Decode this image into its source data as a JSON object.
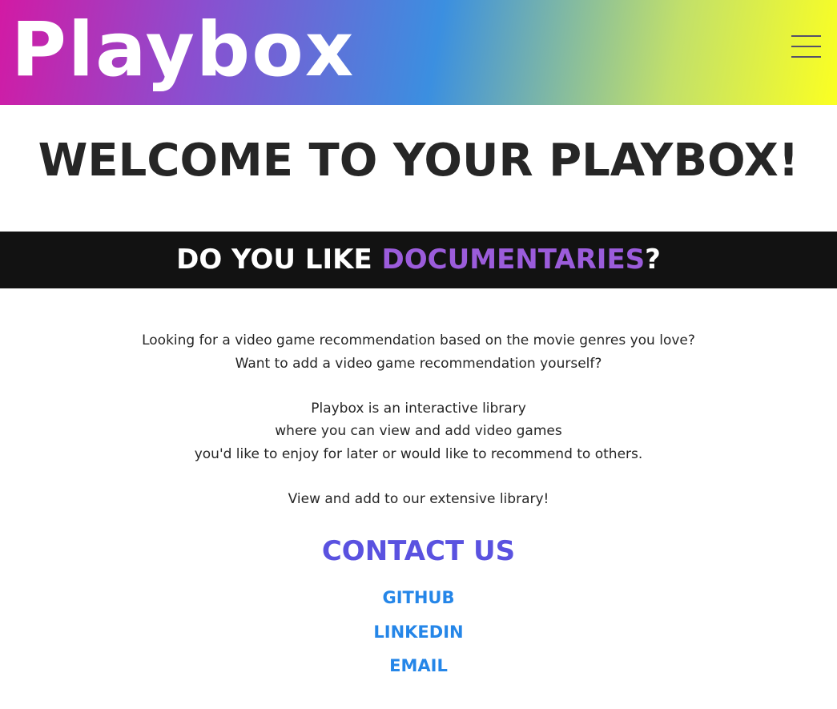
{
  "header": {
    "logo_text": "Playbox",
    "menu_icon": "hamburger-menu-icon",
    "gradient_colors": [
      "#d21aa4",
      "#8a4fd0",
      "#3b8fe0",
      "#c2e06a",
      "#fbff22"
    ]
  },
  "main": {
    "welcome_title": "WELCOME TO YOUR PLAYBOX!",
    "banner": {
      "prefix": "DO YOU LIKE ",
      "genre": "DOCUMENTARIES",
      "suffix": "?",
      "genre_color": "#9b5cdb",
      "background": "#121212"
    },
    "intro_lines": [
      "Looking for a video game recommendation based on the movie genres you love?",
      "Want to add a video game recommendation yourself?",
      "Playbox is an interactive library",
      "where you can view and add video games",
      "you'd like to enjoy for later or would like to recommend to others.",
      "View and add to our extensive library!"
    ]
  },
  "contact": {
    "title": "CONTACT US",
    "title_color": "#5a52e0",
    "link_color": "#2586e8",
    "links": [
      "GITHUB",
      "LINKEDIN",
      "EMAIL"
    ]
  }
}
